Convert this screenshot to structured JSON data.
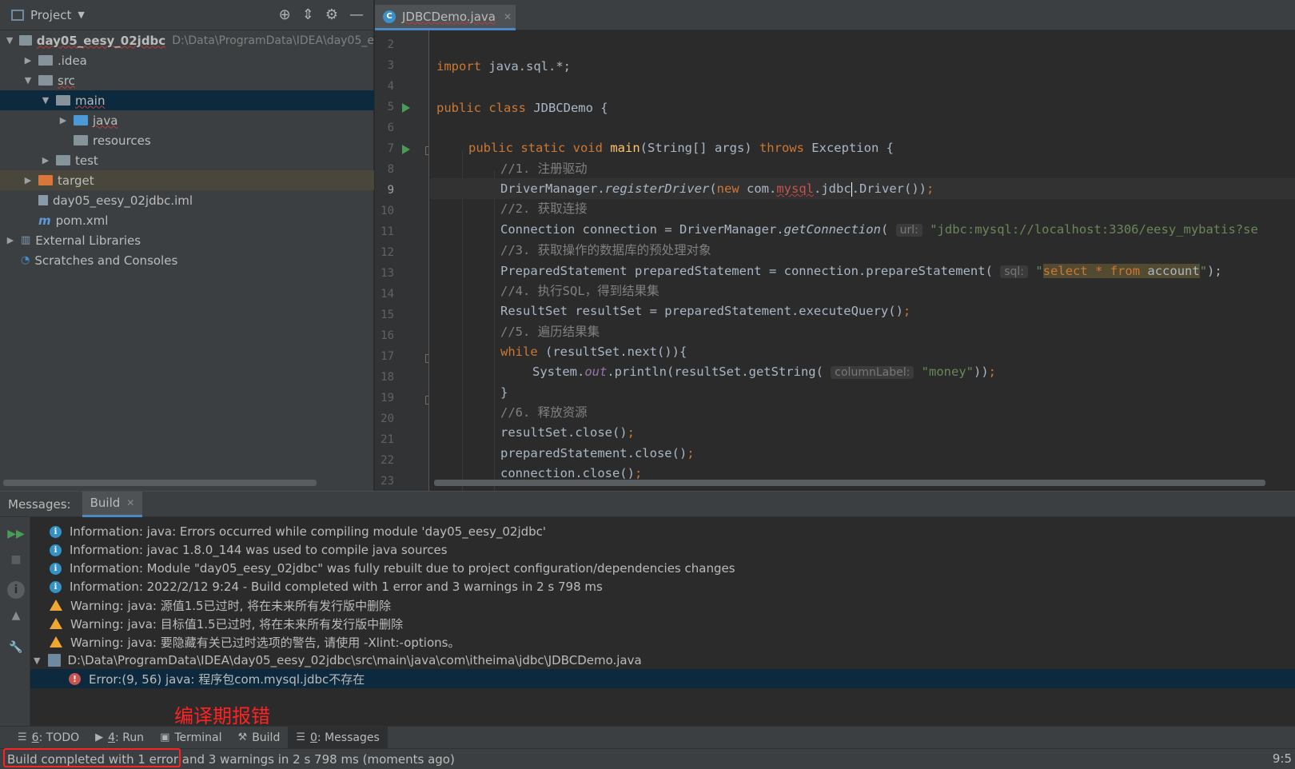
{
  "project_panel": {
    "title": "Project",
    "tree": [
      {
        "label": "day05_eesy_02jdbc",
        "path": "D:\\Data\\ProgramData\\IDEA\\day05_e"
      },
      {
        "label": ".idea"
      },
      {
        "label": "src"
      },
      {
        "label": "main"
      },
      {
        "label": "java"
      },
      {
        "label": "resources"
      },
      {
        "label": "test"
      },
      {
        "label": "target"
      },
      {
        "label": "day05_eesy_02jdbc.iml"
      },
      {
        "label": "pom.xml"
      },
      {
        "label": "External Libraries"
      },
      {
        "label": "Scratches and Consoles"
      }
    ]
  },
  "editor": {
    "tab_label": "JDBCDemo.java",
    "line_numbers": [
      "2",
      "3",
      "4",
      "5",
      "6",
      "7",
      "8",
      "9",
      "10",
      "11",
      "12",
      "13",
      "14",
      "15",
      "16",
      "17",
      "18",
      "19",
      "20",
      "21",
      "22",
      "23"
    ],
    "current_line": "9",
    "code": {
      "l3_import": "import",
      "l3_rest": " java.sql.*;",
      "l5_kw": "public class",
      "l5_name": " JDBCDemo {",
      "l7_kw1": "public static void",
      "l7_fn": "main",
      "l7_args": "(String[] args) ",
      "l7_throws": "throws",
      "l7_exc": " Exception {",
      "l8": "//1. 注册驱动",
      "l9_a": "DriverManager.",
      "l9_method": "registerDriver",
      "l9_b": "(",
      "l9_new": "new",
      "l9_c": " com.",
      "l9_mysql": "mysql",
      "l9_d": ".jdbc",
      "l9_e": ".Driver())",
      "l9_semi": ";",
      "l10": "//2. 获取连接",
      "l11_a": "Connection connection = DriverManager.",
      "l11_method": "getConnection",
      "l11_b": "( ",
      "l11_hint": "url:",
      "l11_str": "\"jdbc:mysql://localhost:3306/eesy_mybatis?se",
      "l12": "//3. 获取操作的数据库的预处理对象",
      "l13_a": "PreparedStatement preparedStatement = connection.prepareStatement( ",
      "l13_hint": "sql:",
      "l13_q1": "\"",
      "l13_sql_kw1": "select * from",
      "l13_sql_rest": " account",
      "l13_q2": "\"",
      "l13_end": ");",
      "l14": "//4. 执行SQL，得到结果集",
      "l15_a": "ResultSet resultSet = preparedStatement.executeQuery()",
      "l15_semi": ";",
      "l16": "//5. 遍历结果集",
      "l17_kw": "while",
      "l17_rest": " (resultSet.next()){",
      "l18_a": "System.",
      "l18_out": "out",
      "l18_b": ".println(resultSet.getString( ",
      "l18_hint": "columnLabel:",
      "l18_str": "\"money\"",
      "l18_end": "))",
      "l18_semi": ";",
      "l19": "}",
      "l20": "//6. 释放资源",
      "l21_a": "resultSet.close()",
      "l21_semi": ";",
      "l22_a": "preparedStatement.close()",
      "l22_semi": ";",
      "l23_a": "connection.close()",
      "l23_semi": ";"
    }
  },
  "messages": {
    "label": "Messages:",
    "tab": "Build",
    "rows": [
      {
        "type": "info",
        "text": "Information: java: Errors occurred while compiling module 'day05_eesy_02jdbc'"
      },
      {
        "type": "info",
        "text": "Information: javac 1.8.0_144 was used to compile java sources"
      },
      {
        "type": "info",
        "text": "Information: Module \"day05_eesy_02jdbc\" was fully rebuilt due to project configuration/dependencies changes"
      },
      {
        "type": "info",
        "text": "Information: 2022/2/12 9:24 - Build completed with 1 error and 3 warnings in 2 s 798 ms"
      },
      {
        "type": "warning",
        "text": "Warning: java: 源值1.5已过时, 将在未来所有发行版中删除"
      },
      {
        "type": "warning",
        "text": "Warning: java: 目标值1.5已过时, 将在未来所有发行版中删除"
      },
      {
        "type": "warning",
        "text": "Warning: java: 要隐藏有关已过时选项的警告, 请使用 -Xlint:-options。"
      },
      {
        "type": "file",
        "text": "D:\\Data\\ProgramData\\IDEA\\day05_eesy_02jdbc\\src\\main\\java\\com\\itheima\\jdbc\\JDBCDemo.java"
      },
      {
        "type": "error",
        "text": "Error:(9, 56)  java: 程序包com.mysql.jdbc不存在"
      }
    ],
    "annotation": "编译期报错"
  },
  "tool_windows": [
    {
      "num": "6",
      "label": ": TODO"
    },
    {
      "num": "4",
      "label": ": Run"
    },
    {
      "num": "",
      "label": "Terminal"
    },
    {
      "num": "",
      "label": "Build"
    },
    {
      "num": "0",
      "label": ": Messages"
    }
  ],
  "status": {
    "text": "Build completed with 1 error and 3 warnings in 2 s 798 ms (moments ago)",
    "right": "9:5"
  },
  "colors": {
    "accent": "#4a88c7",
    "selection": "#0d293e",
    "annotation_red": "#ff2222"
  }
}
